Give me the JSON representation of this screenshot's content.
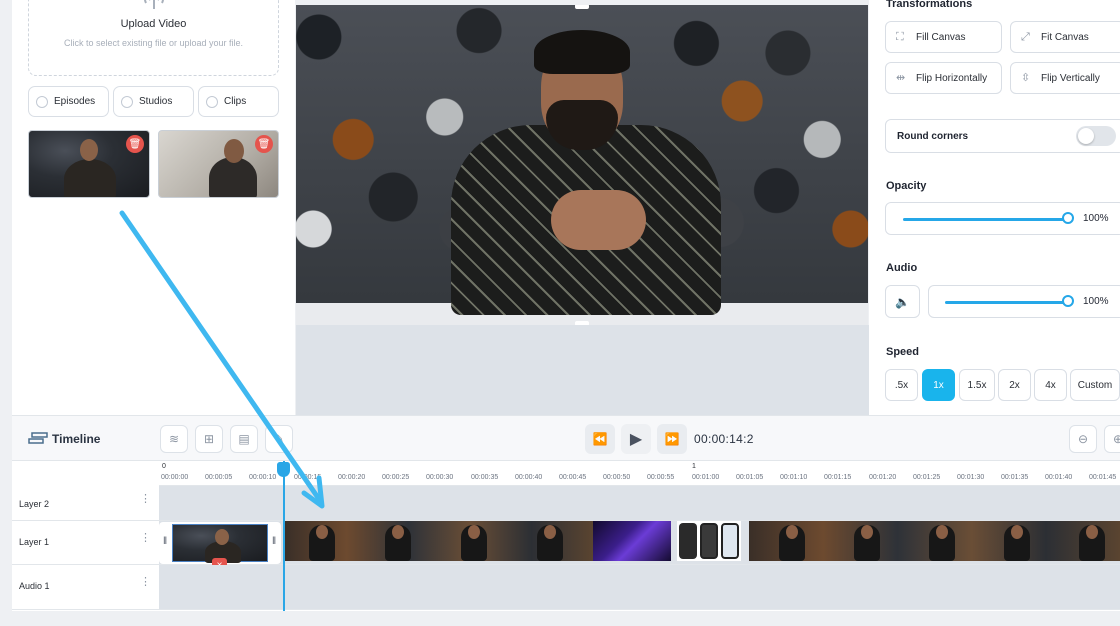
{
  "media_panel": {
    "upload": {
      "title": "Upload Video",
      "subtitle": "Click to select existing file or upload your file."
    },
    "filters": [
      {
        "label": "Episodes",
        "selected": false
      },
      {
        "label": "Studios",
        "selected": false
      },
      {
        "label": "Clips",
        "selected": false
      }
    ]
  },
  "properties": {
    "transformations_label": "Transformations",
    "buttons": {
      "fill_canvas": "Fill Canvas",
      "fit_canvas": "Fit Canvas",
      "flip_horizontally": "Flip Horizontally",
      "flip_vertically": "Flip Vertically"
    },
    "round_corners_label": "Round corners",
    "round_corners_on": false,
    "opacity_label": "Opacity",
    "opacity_value": "100%",
    "opacity_level": 1.0,
    "audio_label": "Audio",
    "audio_value": "100%",
    "audio_level": 1.0,
    "speed_label": "Speed",
    "speed_options": [
      ".5x",
      "1x",
      "1.5x",
      "2x",
      "4x",
      "Custom"
    ],
    "speed_selected": "1x"
  },
  "timeline": {
    "title": "Timeline",
    "time": "00:00:14:2",
    "ruler_markers": [
      "0",
      "1"
    ],
    "ruler_ticks": [
      "00:00:00",
      "00:00:05",
      "00:00:10",
      "00:00:15",
      "00:00:20",
      "00:00:25",
      "00:00:30",
      "00:00:35",
      "00:00:40",
      "00:00:45",
      "00:00:50",
      "00:00:55",
      "00:01:00",
      "00:01:05",
      "00:01:10",
      "00:01:15",
      "00:01:20",
      "00:01:25",
      "00:01:30",
      "00:01:35",
      "00:01:40",
      "00:01:45"
    ],
    "layers": [
      {
        "name": "Layer 2"
      },
      {
        "name": "Layer 1"
      },
      {
        "name": "Audio 1"
      }
    ]
  },
  "colors": {
    "accent": "#19b4ec",
    "arrow": "#3fb8f0",
    "delete": "#e5544d"
  }
}
